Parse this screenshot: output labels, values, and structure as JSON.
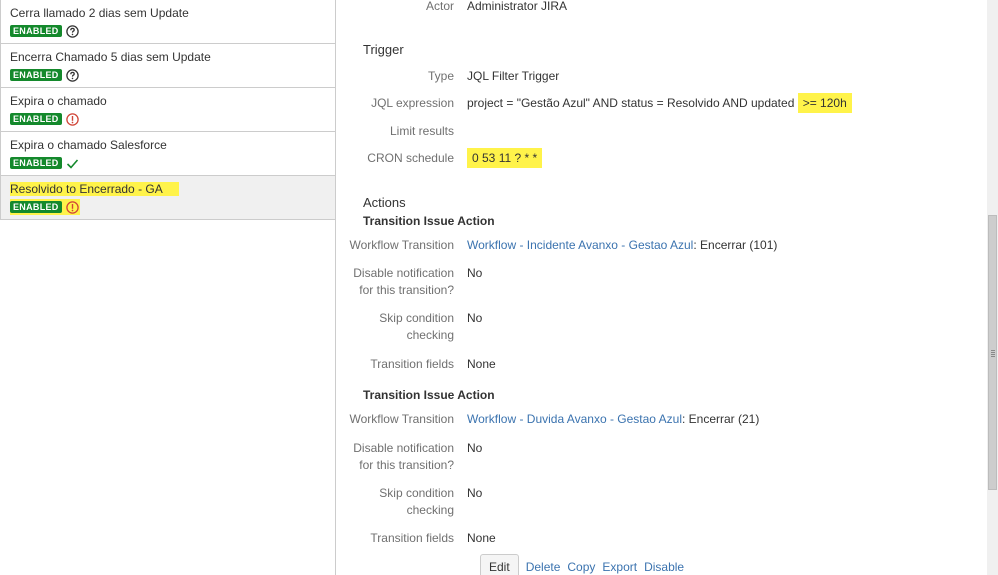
{
  "rules": [
    {
      "name": "Cerra llamado 2 dias sem Update",
      "status": "ENABLED",
      "icon": "help-icon"
    },
    {
      "name": "Encerra Chamado 5 dias sem Update",
      "status": "ENABLED",
      "icon": "help-icon"
    },
    {
      "name": "Expira o chamado",
      "status": "ENABLED",
      "icon": "error-icon"
    },
    {
      "name": "Expira o chamado Salesforce",
      "status": "ENABLED",
      "icon": "check-icon"
    },
    {
      "name": "Resolvido to Encerrado - GA",
      "status": "ENABLED",
      "icon": "error-icon"
    }
  ],
  "detail": {
    "actor": {
      "label": "Actor",
      "value": "Administrator JIRA"
    },
    "trigger": {
      "title": "Trigger",
      "type": {
        "label": "Type",
        "value": "JQL Filter Trigger"
      },
      "jql": {
        "label": "JQL expression",
        "value_prefix": "project = \"Gestão Azul\" AND status = Resolvido AND updated ",
        "value_highlight": ">= 120h"
      },
      "limit": {
        "label": "Limit results",
        "value": ""
      },
      "cron": {
        "label": "CRON schedule",
        "value": "0 53 11 ? * *"
      }
    },
    "actions": {
      "title": "Actions",
      "items": [
        {
          "title": "Transition Issue Action",
          "workflow_label": "Workflow Transition",
          "workflow_link": "Workflow - Incidente Avanxo - Gestao Azul",
          "workflow_suffix": ": Encerrar (101)",
          "disable_label_1": "Disable notification",
          "disable_label_2": "for this transition?",
          "disable_value": "No",
          "skip_label_1": "Skip condition",
          "skip_label_2": "checking",
          "skip_value": "No",
          "fields_label": "Transition fields",
          "fields_value": "None"
        },
        {
          "title": "Transition Issue Action",
          "workflow_label": "Workflow Transition",
          "workflow_link": "Workflow - Duvida Avanxo - Gestao Azul",
          "workflow_suffix": ": Encerrar (21)",
          "disable_label_1": "Disable notification",
          "disable_label_2": "for this transition?",
          "disable_value": "No",
          "skip_label_1": "Skip condition",
          "skip_label_2": "checking",
          "skip_value": "No",
          "fields_label": "Transition fields",
          "fields_value": "None"
        }
      ]
    },
    "buttons": {
      "edit": "Edit",
      "delete": "Delete",
      "copy": "Copy",
      "export": "Export",
      "disable": "Disable"
    }
  },
  "colors": {
    "enabled_badge": "#14892c",
    "highlight": "#fff34a",
    "link": "#3b73af",
    "error": "#d04437"
  }
}
